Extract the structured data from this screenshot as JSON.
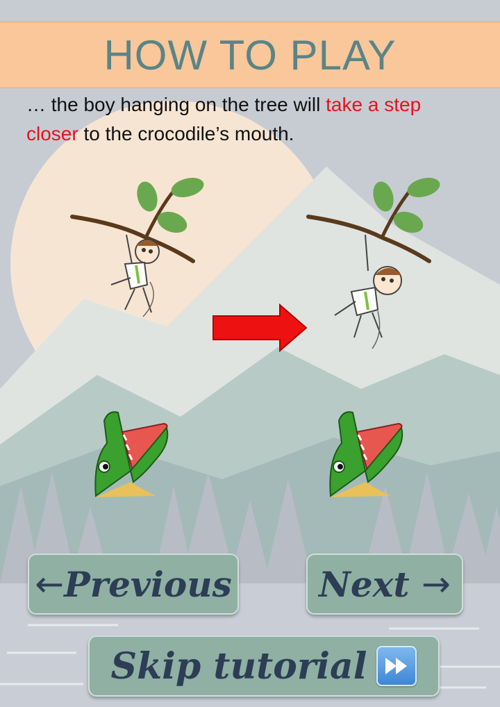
{
  "header": {
    "title": "HOW TO PLAY"
  },
  "instruction": {
    "part1": "… the boy hanging on the tree will ",
    "highlight": "take a step closer",
    "part2": " to the crocodile’s mouth."
  },
  "buttons": {
    "previous": {
      "arrow": "←",
      "label": "Previous"
    },
    "next": {
      "label": "Next",
      "arrow": "→"
    },
    "skip": {
      "label": "Skip tutorial",
      "icon": "fast-forward-icon"
    }
  },
  "colors": {
    "header_bg": "#f9c799",
    "title_text": "#5a8488",
    "highlight_text": "#e8121c",
    "button_bg": "#8fb0a3",
    "button_text": "#2d3d55",
    "arrow": "#ee1111"
  },
  "icons": [
    "branch-icon",
    "hanging-boy-icon",
    "right-arrow-icon",
    "crocodile-icon",
    "fast-forward-icon"
  ]
}
